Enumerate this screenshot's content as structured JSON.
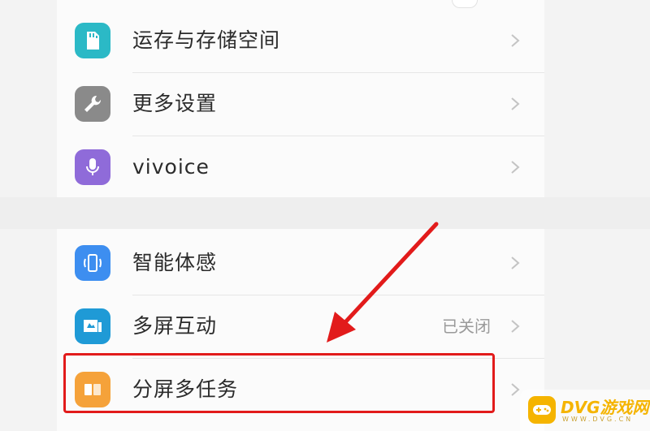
{
  "settings": {
    "items": [
      {
        "label": "运存与存储空间",
        "icon": "storage-icon",
        "color": "#2bb9c6",
        "status": ""
      },
      {
        "label": "更多设置",
        "icon": "wrench-icon",
        "color": "#8a8a8a",
        "status": ""
      },
      {
        "label": "vivoice",
        "icon": "microphone-icon",
        "color": "#8f6bd9",
        "status": ""
      },
      {
        "label": "智能体感",
        "icon": "phone-motion-icon",
        "color": "#3d8ef0",
        "status": ""
      },
      {
        "label": "多屏互动",
        "icon": "screen-cast-icon",
        "color": "#1f9ad6",
        "status": "已关闭"
      },
      {
        "label": "分屏多任务",
        "icon": "split-screen-icon",
        "color": "#f5a23a",
        "status": ""
      }
    ]
  },
  "annotation": {
    "highlight_color": "#e21b1b"
  },
  "watermark": {
    "text": "DVG游戏网",
    "sub": "WWW.DVG.CN",
    "color": "#f5b400"
  }
}
